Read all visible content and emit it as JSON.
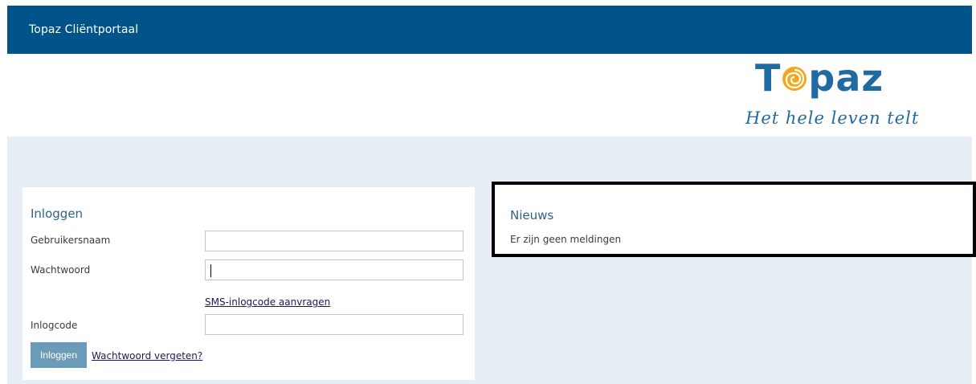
{
  "header": {
    "title": "Topaz Cliëntportaal"
  },
  "logo": {
    "word_before": "T",
    "word_after": "paz",
    "tagline": "Het hele leven telt",
    "brand_color": "#1f6aa1",
    "accent_color": "#f2a81d"
  },
  "login": {
    "title": "Inloggen",
    "username_label": "Gebruikersnaam",
    "username_value": "",
    "password_label": "Wachtwoord",
    "sms_link": "SMS-inlogcode aanvragen",
    "code_label": "Inlogcode",
    "code_value": "",
    "button_label": "Inloggen",
    "forgot_link": "Wachtwoord vergeten?"
  },
  "news": {
    "title": "Nieuws",
    "empty_message": "Er zijn geen meldingen"
  },
  "colors": {
    "header_bg": "#01548a",
    "content_bg": "#e8eef5",
    "button_bg": "#6b9bb8"
  }
}
